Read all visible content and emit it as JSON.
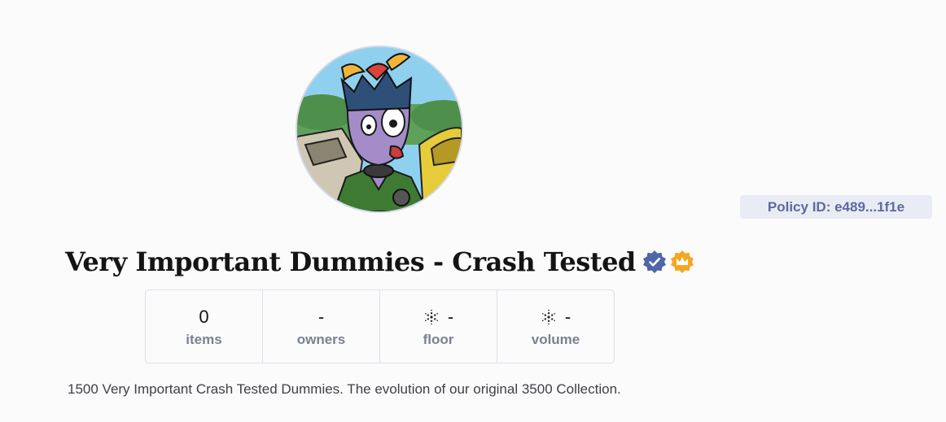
{
  "collection": {
    "title": "Very Important Dummies - Crash Tested",
    "policy_id": "Policy ID: e489...1f1e",
    "description": "1500 Very Important Crash Tested Dummies. The evolution of our original 3500 Collection.",
    "badges": [
      "verified-badge-icon",
      "crown-badge-icon"
    ]
  },
  "stats": [
    {
      "value": "0",
      "label": "items",
      "icon": null
    },
    {
      "value": "-",
      "label": "owners",
      "icon": null
    },
    {
      "value": "-",
      "label": "floor",
      "icon": "cardano-icon"
    },
    {
      "value": "-",
      "label": "volume",
      "icon": "cardano-icon"
    }
  ],
  "colors": {
    "verified_badge": "#4f66a8",
    "crown_badge": "#f5a623",
    "policy_bg": "#e9ecf5",
    "policy_text": "#5c6b9b"
  }
}
